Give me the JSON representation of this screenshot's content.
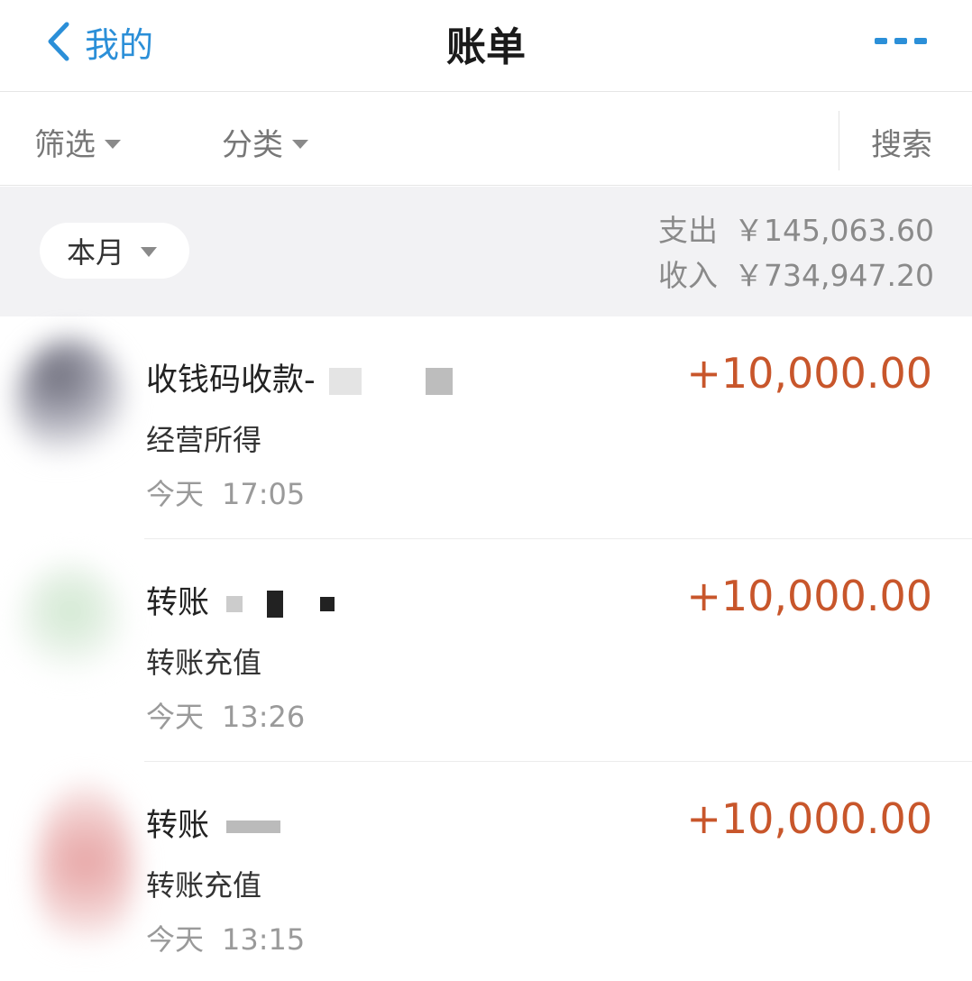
{
  "nav": {
    "back_label": "我的",
    "title": "账单"
  },
  "filters": {
    "filter_label": "筛选",
    "category_label": "分类",
    "search_label": "搜索"
  },
  "month": {
    "label": "本月",
    "expense_label": "支出",
    "expense_value": "￥145,063.60",
    "income_label": "收入",
    "income_value": "￥734,947.20"
  },
  "transactions": [
    {
      "title": "收钱码收款-",
      "category": "经营所得",
      "day": "今天",
      "time": "17:05",
      "amount": "+10,000.00"
    },
    {
      "title": "转账",
      "category": "转账充值",
      "day": "今天",
      "time": "13:26",
      "amount": "+10,000.00"
    },
    {
      "title": "转账",
      "category": "转账充值",
      "day": "今天",
      "time": "13:15",
      "amount": "+10,000.00"
    }
  ],
  "colors": {
    "accent": "#2b8fd8",
    "amount": "#c8562b",
    "header_bg": "#f2f2f4"
  }
}
